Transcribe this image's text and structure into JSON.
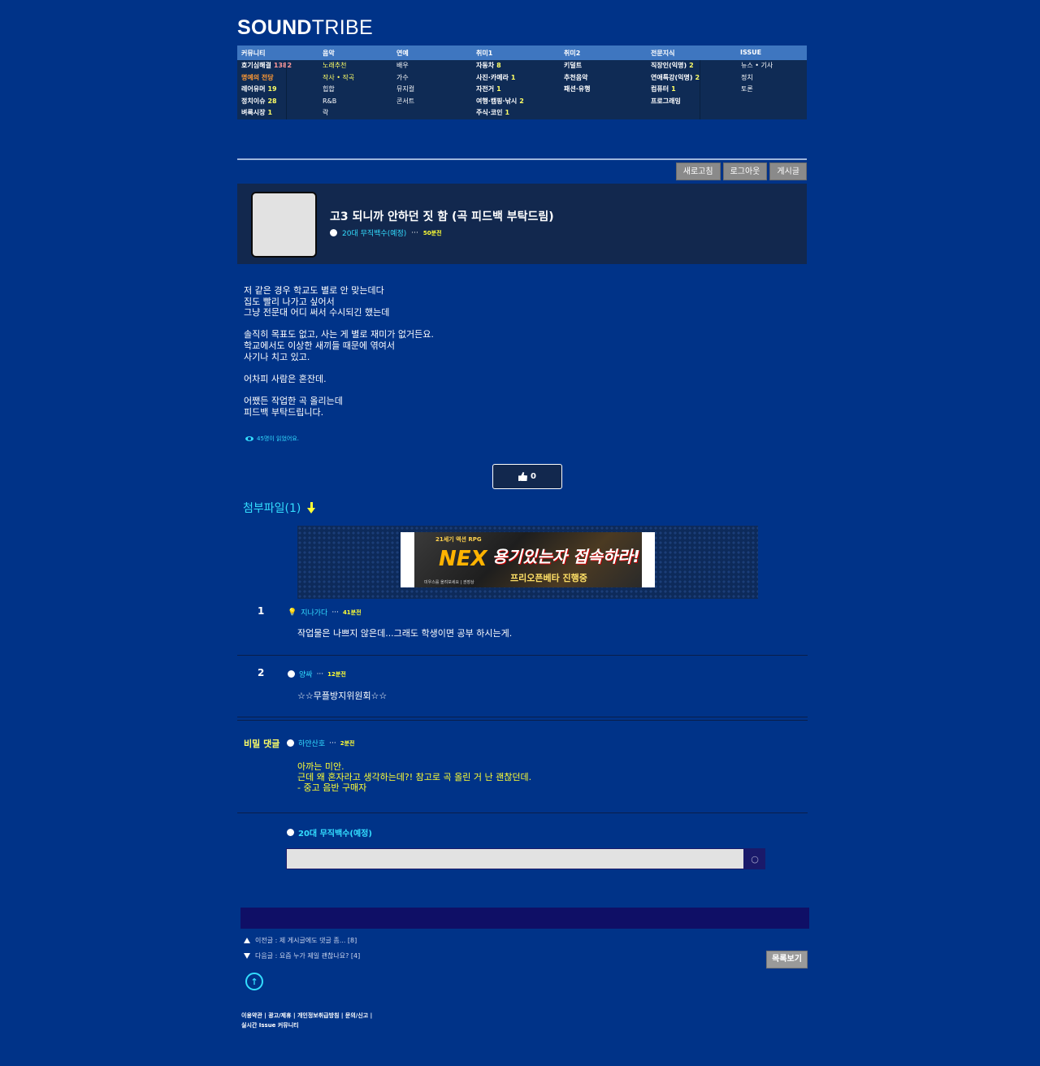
{
  "logo": {
    "bold": "SOUND",
    "light": "TRIBE"
  },
  "nav": {
    "headers": [
      "커뮤니티",
      "음악",
      "연예",
      "취미1",
      "취미2",
      "전문지식",
      "ISSUE"
    ],
    "col1": [
      {
        "label": "호기심해결",
        "count": "1382"
      },
      {
        "label": "명예의 전당",
        "count": ""
      },
      {
        "label": "레어유머",
        "count": "19"
      },
      {
        "label": "정치이슈",
        "count": "28"
      },
      {
        "label": "벼룩시장",
        "count": "1"
      }
    ],
    "col2": [
      "노래추천",
      "작사 • 작곡",
      "힙합",
      "R&B",
      "락"
    ],
    "col3": [
      "배우",
      "가수",
      "뮤지컬",
      "콘서트"
    ],
    "col4": [
      {
        "label": "자동차",
        "count": "8"
      },
      {
        "label": "사진·카메라",
        "count": "1"
      },
      {
        "label": "자전거",
        "count": "1"
      },
      {
        "label": "여행·캠핑·낚시",
        "count": "2"
      },
      {
        "label": "주식·코인",
        "count": "1"
      }
    ],
    "col5": [
      "키덜트",
      "추천음악",
      "패션·유행"
    ],
    "col6": [
      {
        "label": "직장인(익명)",
        "count": "2"
      },
      {
        "label": "연애특강(익명)",
        "count": "2"
      },
      {
        "label": "컴퓨터",
        "count": "1"
      },
      {
        "label": "프로그래밍",
        "count": ""
      }
    ],
    "col7": [
      "뉴스 • 기사",
      "정치",
      "토론"
    ]
  },
  "toolbar": {
    "refresh": "새로고침",
    "logout": "로그아웃",
    "write": "게시글"
  },
  "post": {
    "title": "고3 되니까 안하던 짓 함 (곡 피드백 부탁드림)",
    "author": "20대 무직백수(예정)",
    "time": "50분전",
    "body": "저 같은 경우 학교도 별로 안 맞는데다\n집도 빨리 나가고 싶어서\n그냥 전문대 어디 써서 수시되긴 했는데\n\n솔직히 목표도 없고, 사는 게 별로 재미가 없거든요.\n학교에서도 이상한 새끼들 때문에 엮여서\n사기나 치고 있고.\n\n어차피 사람은 혼잔데.\n\n어쨌든 작업한 곡 올리는데\n피드백 부탁드립니다.",
    "views": "45명이 읽었어요.",
    "likes": "0",
    "attachments": "첨부파일(1)"
  },
  "banner": {
    "tag": "21세기 액션 RPG",
    "logo": "NEX",
    "headline": "용기있는자 접속하라!",
    "sub": "프리오픈베타 진행중",
    "foot": "미우스를 올려보세요 | 권장상"
  },
  "comments": [
    {
      "num": "1",
      "author": "지나가다",
      "time": "41분전",
      "text": "작업물은 나쁘지 않은데...그래도 학생이면 공부 하시는게."
    },
    {
      "num": "2",
      "author": "양싸",
      "time": "12분전",
      "text": "☆☆무플방지위원회☆☆"
    }
  ],
  "secret_comment": {
    "label": "비밀 댓글",
    "author": "하얀산호",
    "time": "2분전",
    "text": "아까는 미안.\n근데 왜 혼자라고 생각하는데?! 참고로 곡 올린 거 난 괜찮던데.\n- 중고 음반 구매자"
  },
  "reply": {
    "author": "20대 무직백수(예정)",
    "value": "",
    "search_icon": "search-icon"
  },
  "prev": "이전글 : 제 게시글에도 댓글 좀... [8]",
  "next": "다음글 : 요즘 누가 제일 괜찮나요? [4]",
  "list_button": "목록보기",
  "footer": {
    "line1": "이용약관 | 광고/제휴 | 개인정보취급방침 | 문의/신고 |",
    "line2": "실시간 Issue 커뮤니티"
  },
  "colors": {
    "bg": "#003388",
    "accent": "#33ddff",
    "highlight": "#ffff33"
  }
}
